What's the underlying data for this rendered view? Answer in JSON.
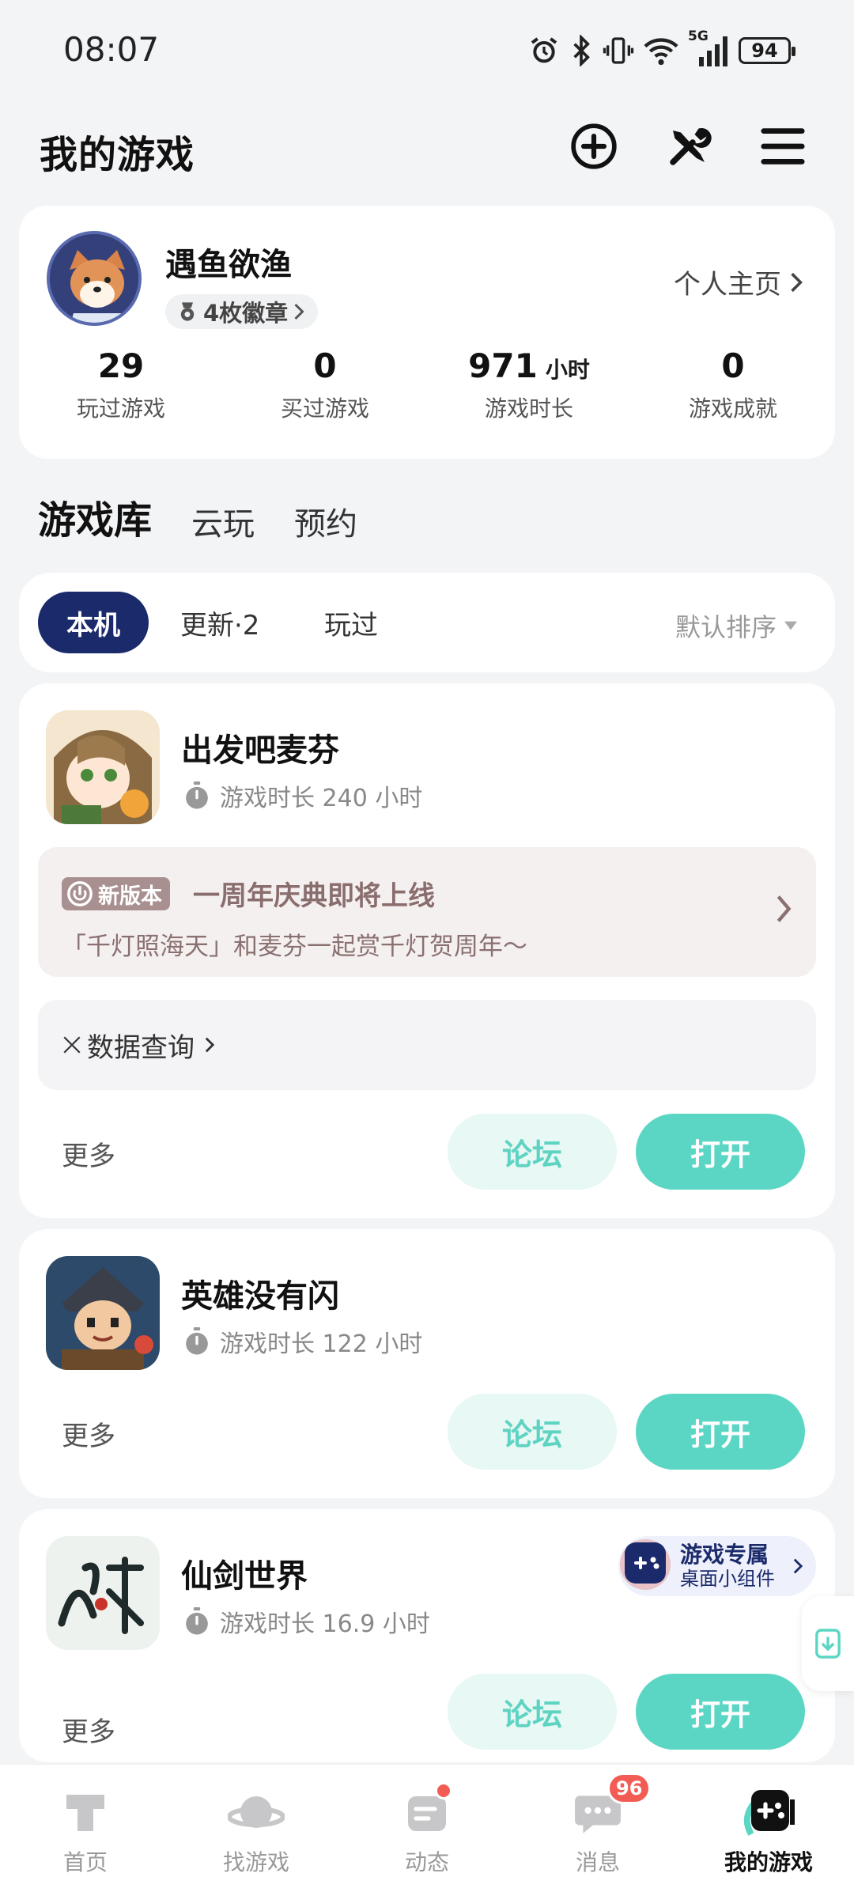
{
  "status_bar": {
    "time": "08:07",
    "battery": "94",
    "network": "5G"
  },
  "header": {
    "title": "我的游戏"
  },
  "profile": {
    "username": "遇鱼欲渔",
    "badges": "4枚徽章",
    "homepage_link": "个人主页",
    "stats": [
      {
        "value": "29",
        "unit": "",
        "label": "玩过游戏"
      },
      {
        "value": "0",
        "unit": "",
        "label": "买过游戏"
      },
      {
        "value": "971",
        "unit": "小时",
        "label": "游戏时长"
      },
      {
        "value": "0",
        "unit": "",
        "label": "游戏成就"
      }
    ]
  },
  "section_tabs": [
    "游戏库",
    "云玩",
    "预约"
  ],
  "filters": {
    "chips": [
      "本机",
      "更新·2",
      "玩过"
    ],
    "sort": "默认排序"
  },
  "games": [
    {
      "name": "出发吧麦芬",
      "playtime": "游戏时长 240 小时",
      "news": {
        "tag": "新版本",
        "title": "一周年庆典即将上线",
        "desc": "「千灯照海天」和麦芬一起赏千灯贺周年～"
      },
      "data_query": "数据查询",
      "more": "更多",
      "forum": "论坛",
      "open": "打开"
    },
    {
      "name": "英雄没有闪",
      "playtime": "游戏时长 122 小时",
      "more": "更多",
      "forum": "论坛",
      "open": "打开"
    },
    {
      "name": "仙剑世界",
      "playtime": "游戏时长 16.9 小时",
      "widget": {
        "line1": "游戏专属",
        "line2": "桌面小组件"
      },
      "more": "更多",
      "forum": "论坛",
      "open": "打开"
    }
  ],
  "bottom_nav": [
    {
      "label": "首页"
    },
    {
      "label": "找游戏"
    },
    {
      "label": "动态"
    },
    {
      "label": "消息",
      "badge": "96"
    },
    {
      "label": "我的游戏"
    }
  ],
  "colors": {
    "accent": "#5cd6c4",
    "navy": "#1b2a6b",
    "badge_red": "#f25c54"
  }
}
